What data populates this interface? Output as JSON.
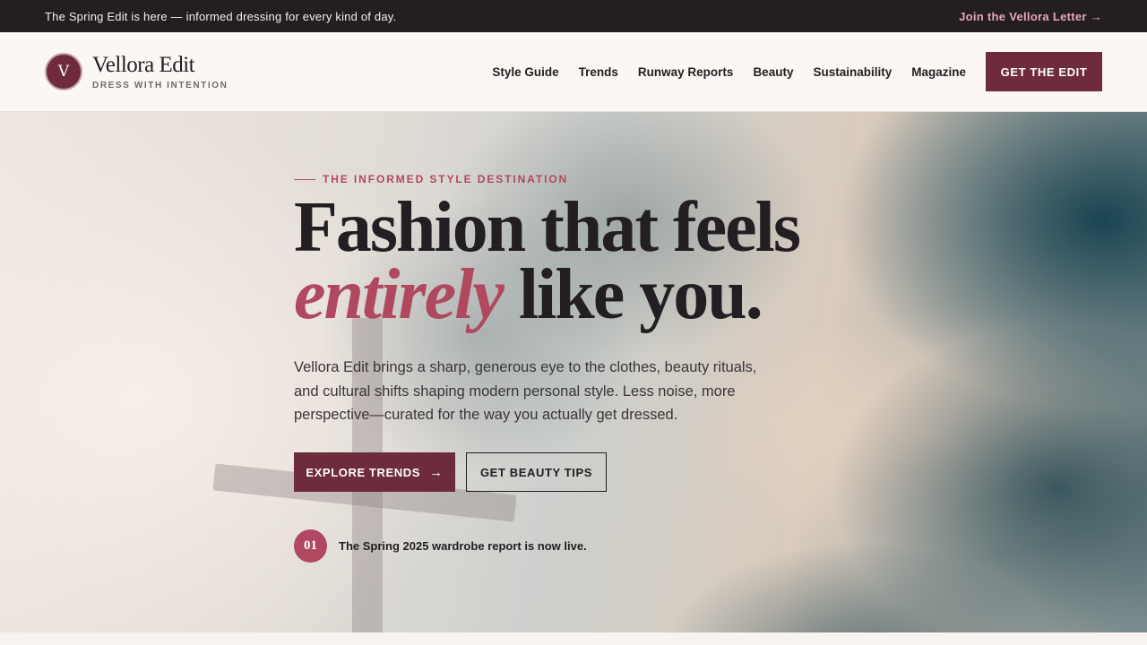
{
  "announcement": {
    "text": "The Spring Edit is here — informed dressing for every kind of day.",
    "cta_label": "Join the Vellora Letter →"
  },
  "brand": {
    "monogram": "V",
    "name": "Vellora Edit",
    "tagline": "DRESS WITH INTENTION"
  },
  "nav": {
    "items": [
      {
        "label": "Style Guide"
      },
      {
        "label": "Trends"
      },
      {
        "label": "Runway Reports"
      },
      {
        "label": "Beauty"
      },
      {
        "label": "Sustainability"
      },
      {
        "label": "Magazine"
      }
    ],
    "cta_label": "GET THE EDIT"
  },
  "hero": {
    "eyebrow": "THE INFORMED STYLE DESTINATION",
    "headline_line1": "Fashion that feels",
    "headline_accent": "entirely",
    "headline_rest": " like you.",
    "body": "Vellora Edit brings a sharp, generous eye to the clothes, beauty rituals, and cultural shifts shaping modern personal style. Less noise, more perspective—curated for the way you actually get dressed.",
    "primary_cta": "EXPLORE TRENDS",
    "primary_cta_icon": "→",
    "secondary_cta": "GET BEAUTY TIPS",
    "news_number": "01",
    "news_text": "The Spring 2025 wardrobe report is now live."
  },
  "colors": {
    "brand": "#6d2b3c",
    "accent": "#b0485f",
    "ink": "#221e22",
    "topbar": "#231e22",
    "topbar_link": "#e8a6b4"
  }
}
